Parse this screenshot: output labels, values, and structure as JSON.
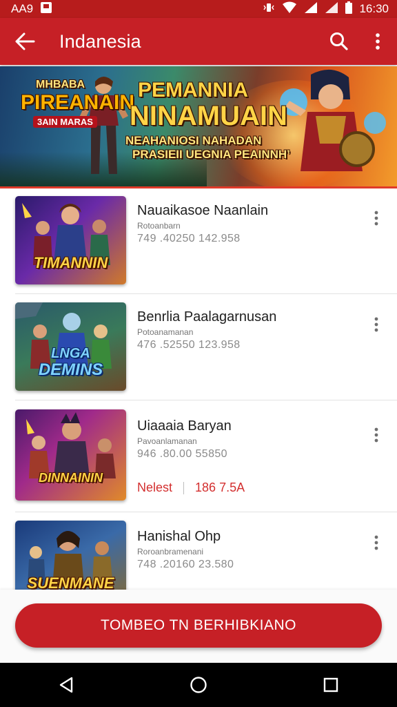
{
  "status_bar": {
    "left_text": "AA9",
    "time": "16:30"
  },
  "app_bar": {
    "title": "Indanesia"
  },
  "banner": {
    "left_small": "MHBABA",
    "left_title": "PIREANAIN",
    "left_sub": "3AIN MARAS",
    "headline_1": "PEMANNIA",
    "headline_2": "NINAMUAIN",
    "subline_1": "NEAHANIOSI NAHADAN",
    "subline_2": "PRASIEII UEGNIA PEAINNH’"
  },
  "games": [
    {
      "title": "Nauaikasoe Naanlain",
      "subtitle": "Rotoanbarn",
      "stats": "749 .40250 142.958",
      "thumb_label": "TIMANNIN"
    },
    {
      "title": "Benrlia Paalagarnusan",
      "subtitle": "Potoanamanan",
      "stats": "476 .52550 123.958",
      "thumb_label": "DEMINS",
      "thumb_label_top": "LNGA"
    },
    {
      "title": "Uiaaaia Baryan",
      "subtitle": "Pavoanlamanan",
      "stats": "946 .80.00 55850",
      "thumb_label": "DINNAININ",
      "status": "Nelest",
      "count": "186 7.5A"
    },
    {
      "title": "Hanishal Ohp",
      "subtitle": "Roroanbramenani",
      "stats": "748 .20160 23.580",
      "thumb_label": "SUENMANE"
    }
  ],
  "cta": {
    "label": "TOMBEO TN BERHIBKIANO"
  },
  "colors": {
    "primary": "#c62026",
    "status_bar": "#b71c1c",
    "accent_text": "#d32f2f"
  }
}
